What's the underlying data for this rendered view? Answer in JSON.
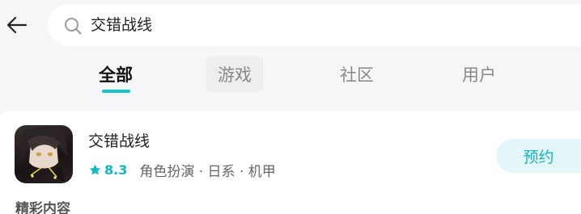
{
  "search": {
    "query": "交错战线"
  },
  "tabs": [
    {
      "label": "全部",
      "active": true
    },
    {
      "label": "游戏",
      "active": false
    },
    {
      "label": "社区",
      "active": false
    },
    {
      "label": "用户",
      "active": false
    }
  ],
  "result": {
    "name": "交错战线",
    "rating": "8.3",
    "tags": "角色扮演 · 日系 · 机甲",
    "action_label": "预约"
  },
  "section": {
    "title": "精彩内容"
  },
  "icons": {
    "back": "arrow-left-icon",
    "search": "search-icon",
    "rating": "star-icon"
  },
  "colors": {
    "accent": "#15c5ce",
    "rating": "#15b7c1",
    "button_bg": "#e3f7f8",
    "button_text": "#1ab0ba",
    "page_bg": "#f5f6f7"
  }
}
